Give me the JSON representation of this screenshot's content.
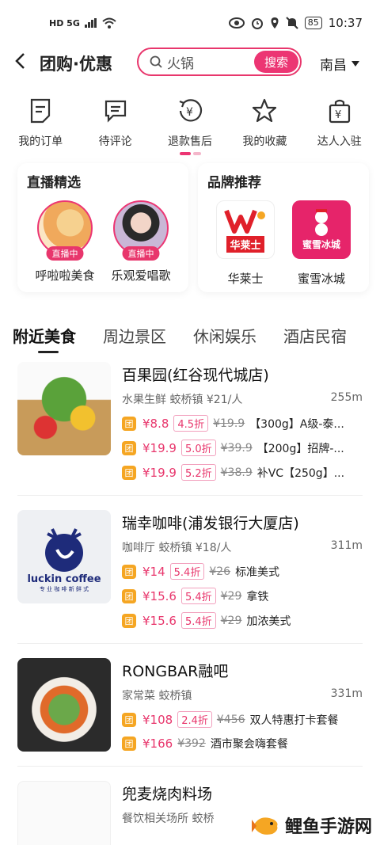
{
  "status_bar": {
    "left": "HD 5G",
    "time": "10:37",
    "battery": "85"
  },
  "header": {
    "title": "团购·优惠",
    "search_value": "火锅",
    "search_button": "搜索",
    "city": "南昌"
  },
  "quick_actions": [
    {
      "label": "我的订单",
      "icon": "order-icon"
    },
    {
      "label": "待评论",
      "icon": "comment-icon"
    },
    {
      "label": "退款售后",
      "icon": "refund-icon"
    },
    {
      "label": "我的收藏",
      "icon": "star-icon"
    },
    {
      "label": "达人入驻",
      "icon": "bag-icon"
    }
  ],
  "live_panel": {
    "title": "直播精选",
    "items": [
      {
        "name": "呼啦啦美食",
        "badge": "直播中"
      },
      {
        "name": "乐观爱唱歌",
        "badge": "直播中"
      }
    ]
  },
  "brand_panel": {
    "title": "品牌推荐",
    "items": [
      {
        "name": "华莱士",
        "logo_text": "华莱士",
        "color": "#e0202a"
      },
      {
        "name": "蜜雪冰城",
        "logo_text": "蜜雪冰城",
        "color": "#e6246a"
      }
    ]
  },
  "tabs": [
    "附近美食",
    "周边景区",
    "休闲娱乐",
    "酒店民宿"
  ],
  "shops": [
    {
      "name": "百果园(红谷现代城店)",
      "category": "水果生鲜 蛟桥镇 ¥21/人",
      "distance": "255m",
      "deals": [
        {
          "price": "¥8.8",
          "discount": "4.5折",
          "original": "¥19.9",
          "title": "【300g】A级-泰..."
        },
        {
          "price": "¥19.9",
          "discount": "5.0折",
          "original": "¥39.9",
          "title": "【200g】招牌-..."
        },
        {
          "price": "¥19.9",
          "discount": "5.2折",
          "original": "¥38.9",
          "title": "补VC【250g】..."
        }
      ]
    },
    {
      "name": "瑞幸咖啡(浦发银行大厦店)",
      "category": "咖啡厅 蛟桥镇 ¥18/人",
      "distance": "311m",
      "logo_text": "luckin coffee",
      "logo_sub": "专 业 咖 啡 新 鲜 式",
      "deals": [
        {
          "price": "¥14",
          "discount": "5.4折",
          "original": "¥26",
          "title": "标准美式"
        },
        {
          "price": "¥15.6",
          "discount": "5.4折",
          "original": "¥29",
          "title": "拿铁"
        },
        {
          "price": "¥15.6",
          "discount": "5.4折",
          "original": "¥29",
          "title": "加浓美式"
        }
      ]
    },
    {
      "name": "RONGBAR融吧",
      "category": "家常菜 蛟桥镇",
      "distance": "331m",
      "deals": [
        {
          "price": "¥108",
          "discount": "2.4折",
          "original": "¥456",
          "title": "双人特惠打卡套餐"
        },
        {
          "price": "¥166",
          "discount": "",
          "original": "¥392",
          "title": "酒市聚会嗨套餐"
        }
      ]
    },
    {
      "name": "兜麦烧肉料场",
      "category": "餐饮相关场所 蛟桥",
      "distance": "",
      "deals": []
    }
  ],
  "tuan_icon": "团",
  "watermark": "鲤鱼手游网"
}
